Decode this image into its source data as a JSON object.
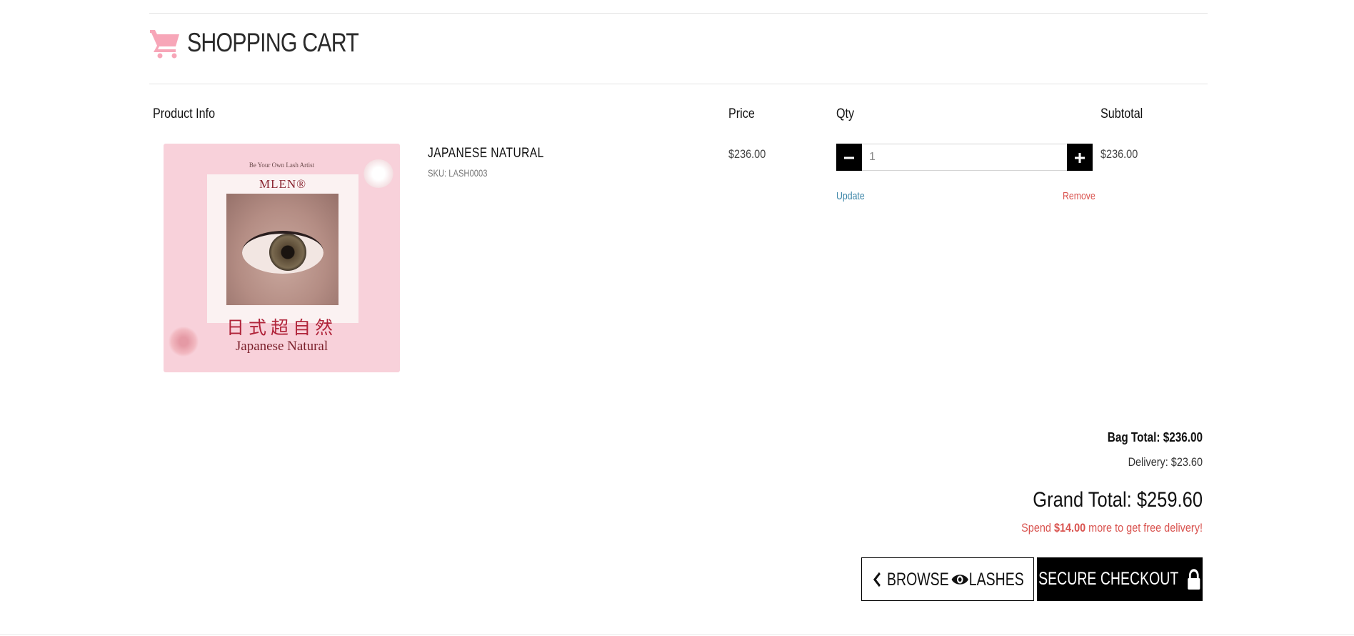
{
  "header": {
    "title": "SHOPPING CART",
    "icon": "shopping-cart-icon",
    "accent_color": "#f7a6b8"
  },
  "columns": {
    "product_info": "Product Info",
    "price": "Price",
    "qty": "Qty",
    "subtotal": "Subtotal"
  },
  "items": [
    {
      "name": "JAPANESE NATURAL",
      "sku": "SKU: LASH0003",
      "price": "$236.00",
      "quantity": "1",
      "subtotal": "$236.00",
      "update_label": "Update",
      "remove_label": "Remove",
      "image": {
        "tagline": "Be Your Own Lash Artist",
        "brand": "MLEN®",
        "chinese_name": "日式超自然",
        "english_name": "Japanese Natural"
      }
    }
  ],
  "totals": {
    "bag_total": "Bag Total: $236.00",
    "delivery": "Delivery: $23.60",
    "grand_total": "Grand Total: $259.60",
    "free_delivery_prefix": "Spend ",
    "free_delivery_amount": "$14.00",
    "free_delivery_suffix": " more to get free delivery!"
  },
  "actions": {
    "browse_prefix": "BROWSE",
    "browse_suffix": "LASHES",
    "checkout_label": "SECURE CHECKOUT",
    "browse_icons": [
      "chevron-left-icon",
      "eye-icon"
    ],
    "checkout_icon": "lock-icon"
  }
}
